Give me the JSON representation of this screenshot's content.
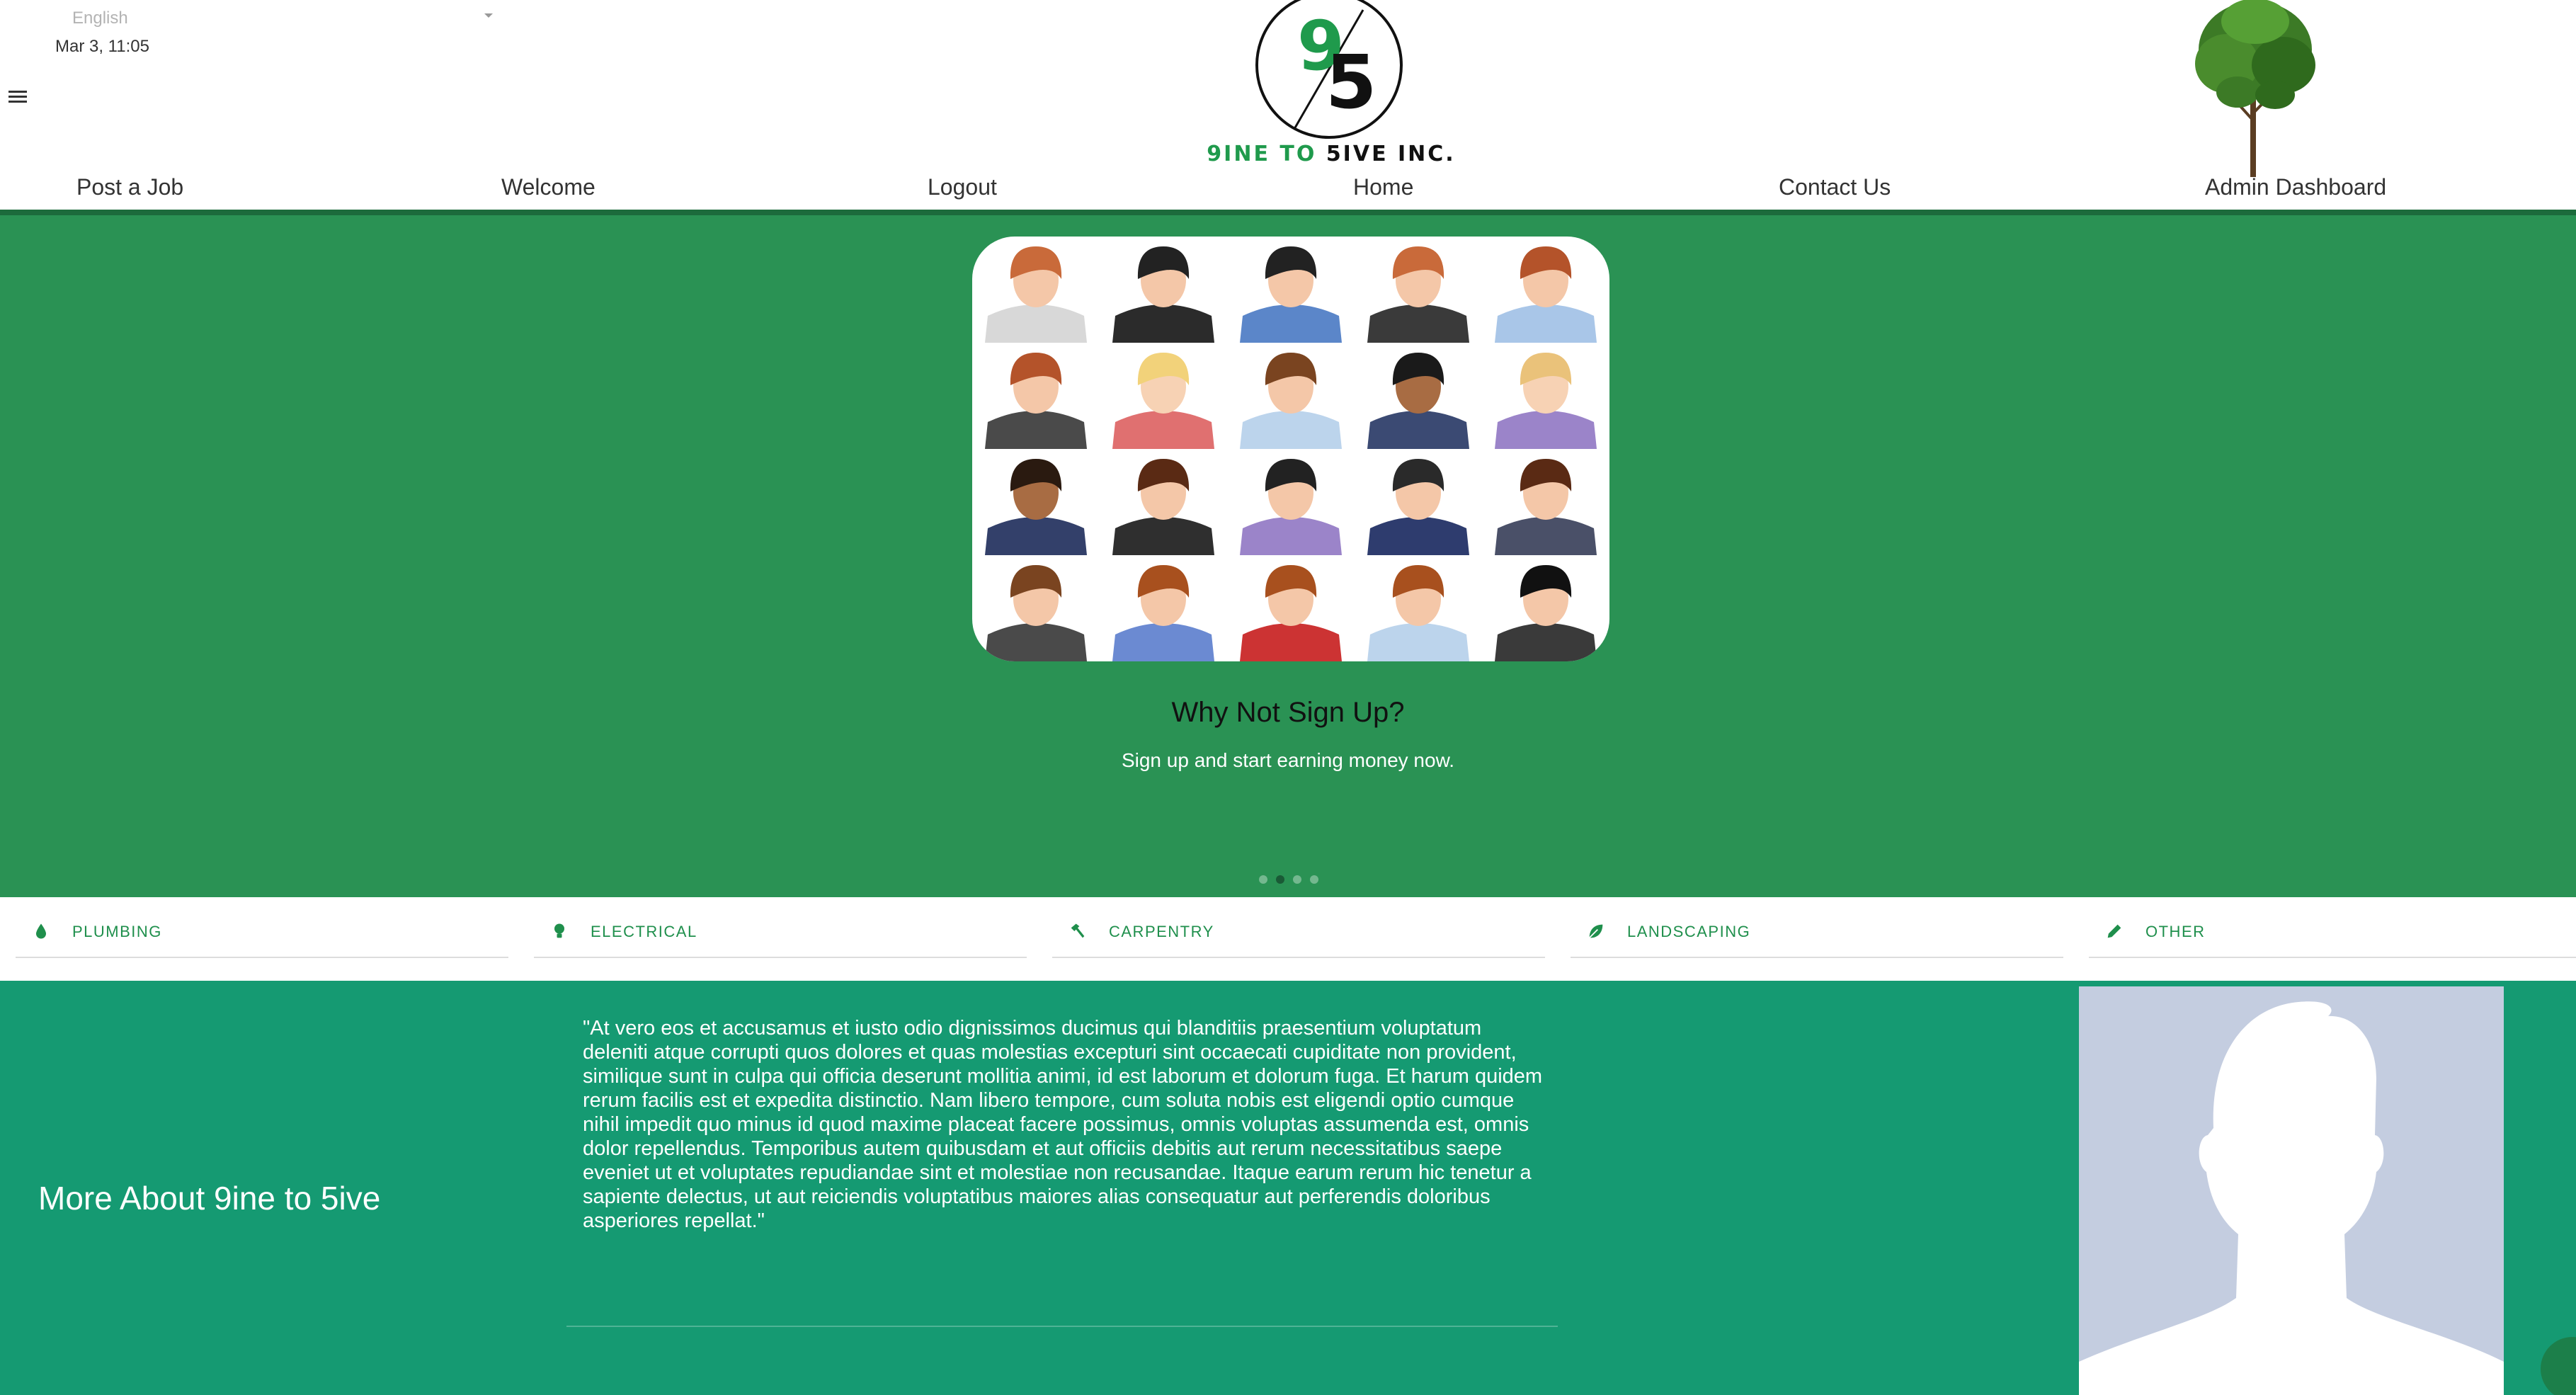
{
  "header": {
    "language": "English",
    "datetime": "Mar 3, 11:05",
    "logo_text_green": "9INE TO",
    "logo_text_dark": "5IVE INC."
  },
  "nav": {
    "items": [
      "Post a Job",
      "Welcome",
      "Logout",
      "Home",
      "Contact Us",
      "Admin Dashboard"
    ]
  },
  "hero": {
    "title": "Why Not Sign Up?",
    "subtitle": "Sign up and start earning money now.",
    "slide_count": 4,
    "active_slide": 2
  },
  "categories": {
    "items": [
      {
        "label": "PLUMBING",
        "icon": "water-drop-icon"
      },
      {
        "label": "ELECTRICAL",
        "icon": "lightbulb-icon"
      },
      {
        "label": "CARPENTRY",
        "icon": "hammer-icon"
      },
      {
        "label": "LANDSCAPING",
        "icon": "leaf-icon"
      },
      {
        "label": "OTHER",
        "icon": "pencil-icon"
      }
    ]
  },
  "about": {
    "title": "More About 9ine to 5ive",
    "quote": "\"At vero eos et accusamus et iusto odio dignissimos ducimus qui blanditiis praesentium voluptatum deleniti atque corrupti quos dolores et quas molestias excepturi sint occaecati cupiditate non provident, similique sunt in culpa qui officia deserunt mollitia animi, id est laborum et dolorum fuga. Et harum quidem rerum facilis est et expedita distinctio. Nam libero tempore, cum soluta nobis est eligendi optio cumque nihil impedit quo minus id quod maxime placeat facere possimus, omnis voluptas assumenda est, omnis dolor repellendus. Temporibus autem quibusdam et aut officiis debitis aut rerum necessitatibus saepe eveniet ut et voluptates repudiandae sint et molestiae non recusandae. Itaque earum rerum hic tenetur a sapiente delectus, ut aut reiciendis voluptatibus maiores alias consequatur aut perferendis doloribus asperiores repellat.\""
  },
  "colors": {
    "hero_green": "#2a9254",
    "about_teal": "#159a72",
    "accent_green": "#1f8f4c",
    "nav_underline": "#1c6b3c"
  }
}
